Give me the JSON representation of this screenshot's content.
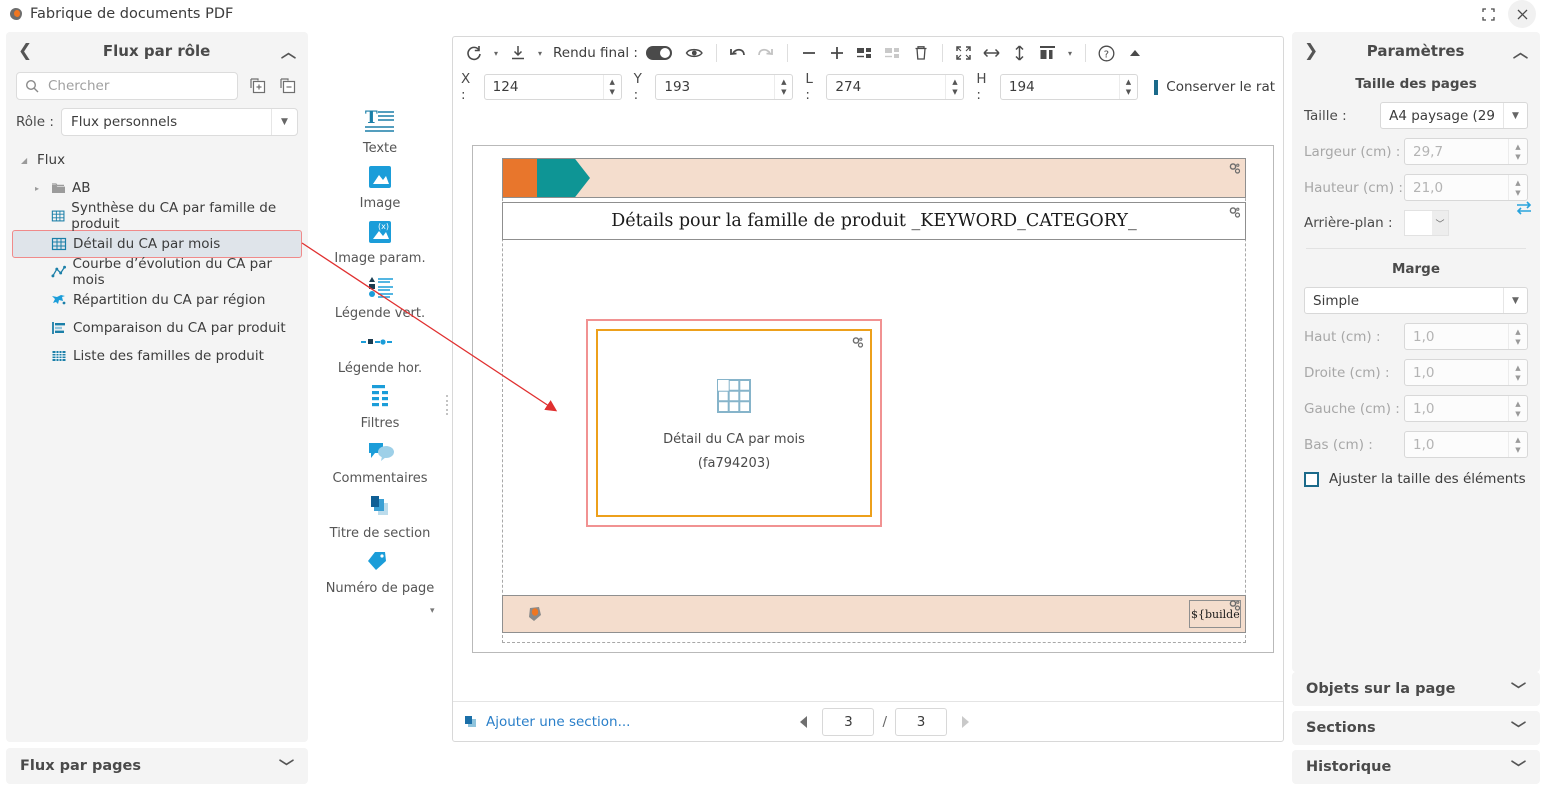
{
  "window": {
    "title": "Fabrique de documents PDF",
    "app_icon": "app-blob-icon",
    "restore_label": "⛶",
    "close_label": "✕"
  },
  "left_panel": {
    "back_chevron": "❮",
    "title": "Flux par rôle",
    "collapse_chevron": "︿",
    "search": {
      "placeholder": "Chercher",
      "value": ""
    },
    "buttons": [
      {
        "name": "add-copies-icon",
        "label": "＋"
      },
      {
        "name": "remove-copies-icon",
        "label": "－"
      }
    ],
    "role": {
      "label": "Rôle :",
      "value": "Flux personnels",
      "arrow": "▼"
    },
    "tree": [
      {
        "label": "Flux",
        "level": 0,
        "twisty": "◢",
        "icon": "",
        "selected": false
      },
      {
        "label": "AB",
        "level": 1,
        "twisty": "▸",
        "icon": "folder-icon",
        "selected": false
      },
      {
        "label": "Synthèse du CA par famille de produit",
        "level": 2,
        "twisty": "",
        "icon": "grid-table-icon",
        "selected": false
      },
      {
        "label": "Détail du CA par mois",
        "level": 2,
        "twisty": "",
        "icon": "grid-table-icon",
        "selected": true
      },
      {
        "label": "Courbe d’évolution du CA par mois",
        "level": 2,
        "twisty": "",
        "icon": "line-chart-icon",
        "selected": false
      },
      {
        "label": "Répartition du CA par région",
        "level": 2,
        "twisty": "",
        "icon": "map-icon",
        "selected": false
      },
      {
        "label": "Comparaison du CA par produit",
        "level": 2,
        "twisty": "",
        "icon": "bar-chart-icon",
        "selected": false
      },
      {
        "label": "Liste des familles de produit",
        "level": 2,
        "twisty": "",
        "icon": "table-list-icon",
        "selected": false
      }
    ],
    "bottom_accordion": {
      "label": "Flux par pages",
      "chevron": "﹀"
    }
  },
  "tool_palette": {
    "items": [
      {
        "label": "Texte",
        "icon": "text-icon"
      },
      {
        "label": "Image",
        "icon": "image-icon"
      },
      {
        "label": "Image param.",
        "icon": "parametric-image-icon"
      },
      {
        "label": "Légende vert.",
        "icon": "vertical-legend-icon"
      },
      {
        "label": "Légende hor.",
        "icon": "horizontal-legend-icon"
      },
      {
        "label": "Filtres",
        "icon": "filters-icon"
      },
      {
        "label": "Commentaires",
        "icon": "comments-icon"
      },
      {
        "label": "Titre de section",
        "icon": "section-title-icon"
      },
      {
        "label": "Numéro de page",
        "icon": "page-number-icon"
      }
    ],
    "more_arrow": "▾"
  },
  "toolbar": {
    "refresh_icon": "refresh-icon",
    "refresh_caret": "▾",
    "download_icon": "download-icon",
    "download_caret": "▾",
    "render_label": "Rendu final :",
    "render_toggle_on": true,
    "preview_icon": "eye-icon",
    "undo_icon": "undo-icon",
    "redo_icon": "redo-icon",
    "minus_icon": "minus-icon",
    "plus_icon": "plus-icon",
    "group_icon": "group-cells-icon",
    "ungroup_icon": "ungroup-cells-icon",
    "delete_icon": "trash-icon",
    "fit_icon": "fit-page-icon",
    "fit_width_icon": "fit-width-icon",
    "fit_height_icon": "fit-height-icon",
    "layout_icon": "layout-icon",
    "layout_caret": "▾",
    "help_icon": "help-icon",
    "collapse_icon": "collapse-toolbar-icon"
  },
  "coords": {
    "x": {
      "label": "X :",
      "value": "124"
    },
    "y": {
      "label": "Y :",
      "value": "193"
    },
    "l": {
      "label": "L :",
      "value": "274"
    },
    "h": {
      "label": "H :",
      "value": "194"
    },
    "keep_ratio": {
      "label": "Conserver le rat",
      "checked": false
    }
  },
  "canvas": {
    "page_title": "Détails pour la famille de produit _KEYWORD_CATEGORY_",
    "selected_object": {
      "label": "Détail du CA par mois",
      "id": "(fa794203)",
      "icon": "grid-table-icon"
    },
    "footer_tag": "${builder.",
    "footer_logo": "app-blob-icon",
    "gear_badge_icon": "gear-settings-icon",
    "colors": {
      "band_bg": "#f4ddcd",
      "chevron_orange": "#e8762c",
      "chevron_teal": "#0e9595",
      "selection_outer": "#f19292",
      "selection_inner": "#eda01b",
      "accent_blue": "#1b9dd9"
    }
  },
  "bottombar": {
    "add_section_label": "Ajouter une section...",
    "add_section_icon": "add-section-icon",
    "prev_icon": "◀",
    "next_icon": "▶",
    "current_page": "3",
    "separator": "/",
    "total_pages": "3"
  },
  "right_panel": {
    "expand_chevron": "❯",
    "title": "Paramètres",
    "collapse_chevron": "︿",
    "page_size": {
      "section_title": "Taille des pages",
      "size": {
        "label": "Taille :",
        "value": "A4 paysage (29",
        "arrow": "▼"
      },
      "width": {
        "label": "Largeur (cm) :",
        "value": "29,7",
        "disabled": true
      },
      "height": {
        "label": "Hauteur (cm) :",
        "value": "21,0",
        "disabled": true
      },
      "swap_icon": "swap-dimensions-icon",
      "background": {
        "label": "Arrière-plan :",
        "value": "",
        "arrow": "﹀"
      }
    },
    "margin": {
      "section_title": "Marge",
      "preset": {
        "value": "Simple",
        "arrow": "▼"
      },
      "top": {
        "label": "Haut (cm) :",
        "value": "1,0",
        "disabled": true
      },
      "right": {
        "label": "Droite (cm) :",
        "value": "1,0",
        "disabled": true
      },
      "left": {
        "label": "Gauche (cm) :",
        "value": "1,0",
        "disabled": true
      },
      "bottom": {
        "label": "Bas (cm) :",
        "value": "1,0",
        "disabled": true
      },
      "adjust_checkbox": {
        "label": "Ajuster la taille des éléments",
        "checked": false
      }
    },
    "accordions": [
      {
        "label": "Objets sur la page",
        "chevron": "﹀"
      },
      {
        "label": "Sections",
        "chevron": "﹀"
      },
      {
        "label": "Historique",
        "chevron": "﹀"
      }
    ]
  }
}
